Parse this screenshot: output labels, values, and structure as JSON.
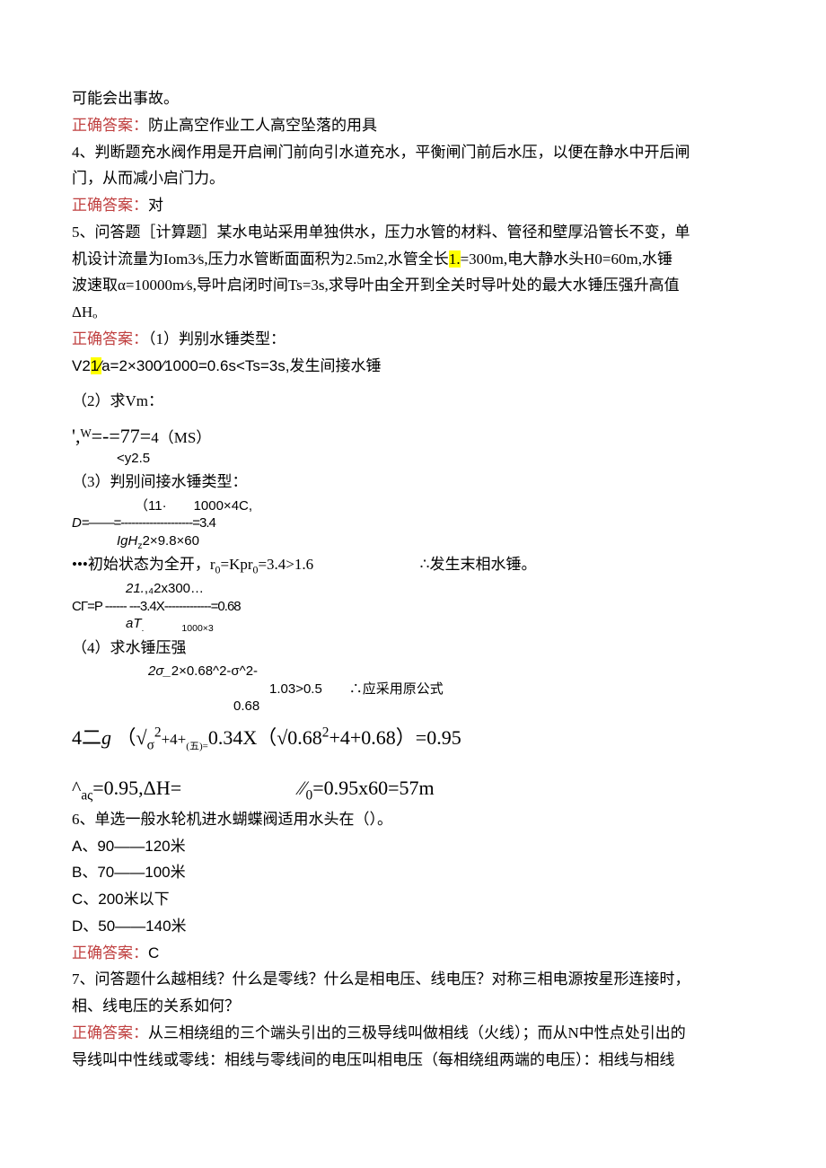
{
  "l1": "可能会出事故。",
  "ansLabel": "正确答案：",
  "l2": "防止高空作业工人高空坠落的用具",
  "q4a": "4、判断题充水阀作用是开启闸门前向引水道充水，平衡闸门前后水压，以便在静水中开后闸",
  "q4b": "门，从而减小启门力。",
  "a4": "对",
  "q5a": "5、问答题［计算题］某水电站采用单独供水，压力水管的材料、管径和壁厚沿管长不变，单",
  "q5b_pre": "机设计流量为Iom3⁄s,压力水管断面面积为2.5m2,水管全长",
  "q5b_hl": "1.",
  "q5b_post": "=300m,电大静水头H0=60m,水锤",
  "q5c": "波速取α=10000m⁄s,导叶启闭时间Ts=3s,求导叶由全开到全关时导叶处的最大水锤压强升高值",
  "q5d": "ΔHₒ",
  "a5_1": "（1）判别水锤类型：",
  "a5_2_pre": "V2",
  "a5_2_hl": "1⁄",
  "a5_2_post": "a=2×300⁄1000=0.6s<Ts=3s,发生间接水锤",
  "a5_3": "（2）求Vm：",
  "a5_f1a": "',ᵂ=-=77=",
  "a5_f1b": "4（MS）",
  "a5_f1c": "<y2.5",
  "a5_4": "（3）判别间接水锤类型：",
  "a5_f2a": "（11·　　1000×4C,",
  "a5_f2b_i": "D",
  "a5_f2b": "=——=--------------------=3.4",
  "a5_f2c_i": "IgH",
  "a5_f2c_sub": "z",
  "a5_f2c": "2×9.8×60",
  "a5_5a": "•••初始状态为全开，r",
  "a5_5b": "=Kpr",
  "a5_5c": "=3.4>1.6",
  "a5_5d": "∴发生末相水锤。",
  "a5_f3a_i": "21.",
  "a5_f3a": ",₄2x300…",
  "a5_f3b": "CΓ=P ------ ---3.4X-------------=0.68",
  "a5_f3c_i": "aT",
  "a5_f3c": ".　　　　1000×3",
  "a5_6": "（4）求水锤压强",
  "a5_f4a_i": "2σ_",
  "a5_f4a": "2×0.68^2-σ^2-",
  "a5_f4b": "1.03>0.5　　∴应采用原公式",
  "a5_f4c": "0.68",
  "a5_f5a": "4二",
  "a5_f5a_g": "g",
  "a5_f5b": "（√",
  "a5_f5b_s": "σ",
  "a5_f5c": "+4+",
  "a5_f5c_s": "(五)=",
  "a5_f5d": "0.34X（√0.68",
  "a5_f5e": "+4+0.68）=0.95",
  "a5_f6a": "^",
  "a5_f6a_s": "aς",
  "a5_f6b": "=0.95,ΔH=",
  "a5_f6c": "⁄⁄",
  "a5_f6c_s": "0",
  "a5_f6d": "=0.95x60=57m",
  "q6": "6、单选一般水轮机进水蝴蝶阀适用水头在（）。",
  "q6a": "A、90——120米",
  "q6b": "B、70——100米",
  "q6c": "C、200米以下",
  "q6d": "D、50——140米",
  "a6": "C",
  "q7a": "7、问答题什么越相线？什么是零线？什么是相电压、线电压？对称三相电源按星形连接时，",
  "q7b": "相、线电压的关系如何？",
  "a7a": "从三相绕组的三个端头引出的三极导线叫做相线（火线）；而从N中性点处引出的",
  "a7b": "导线叫中性线或零线：相线与零线间的电压叫相电压（每相绕组两端的电压）：相线与相线"
}
